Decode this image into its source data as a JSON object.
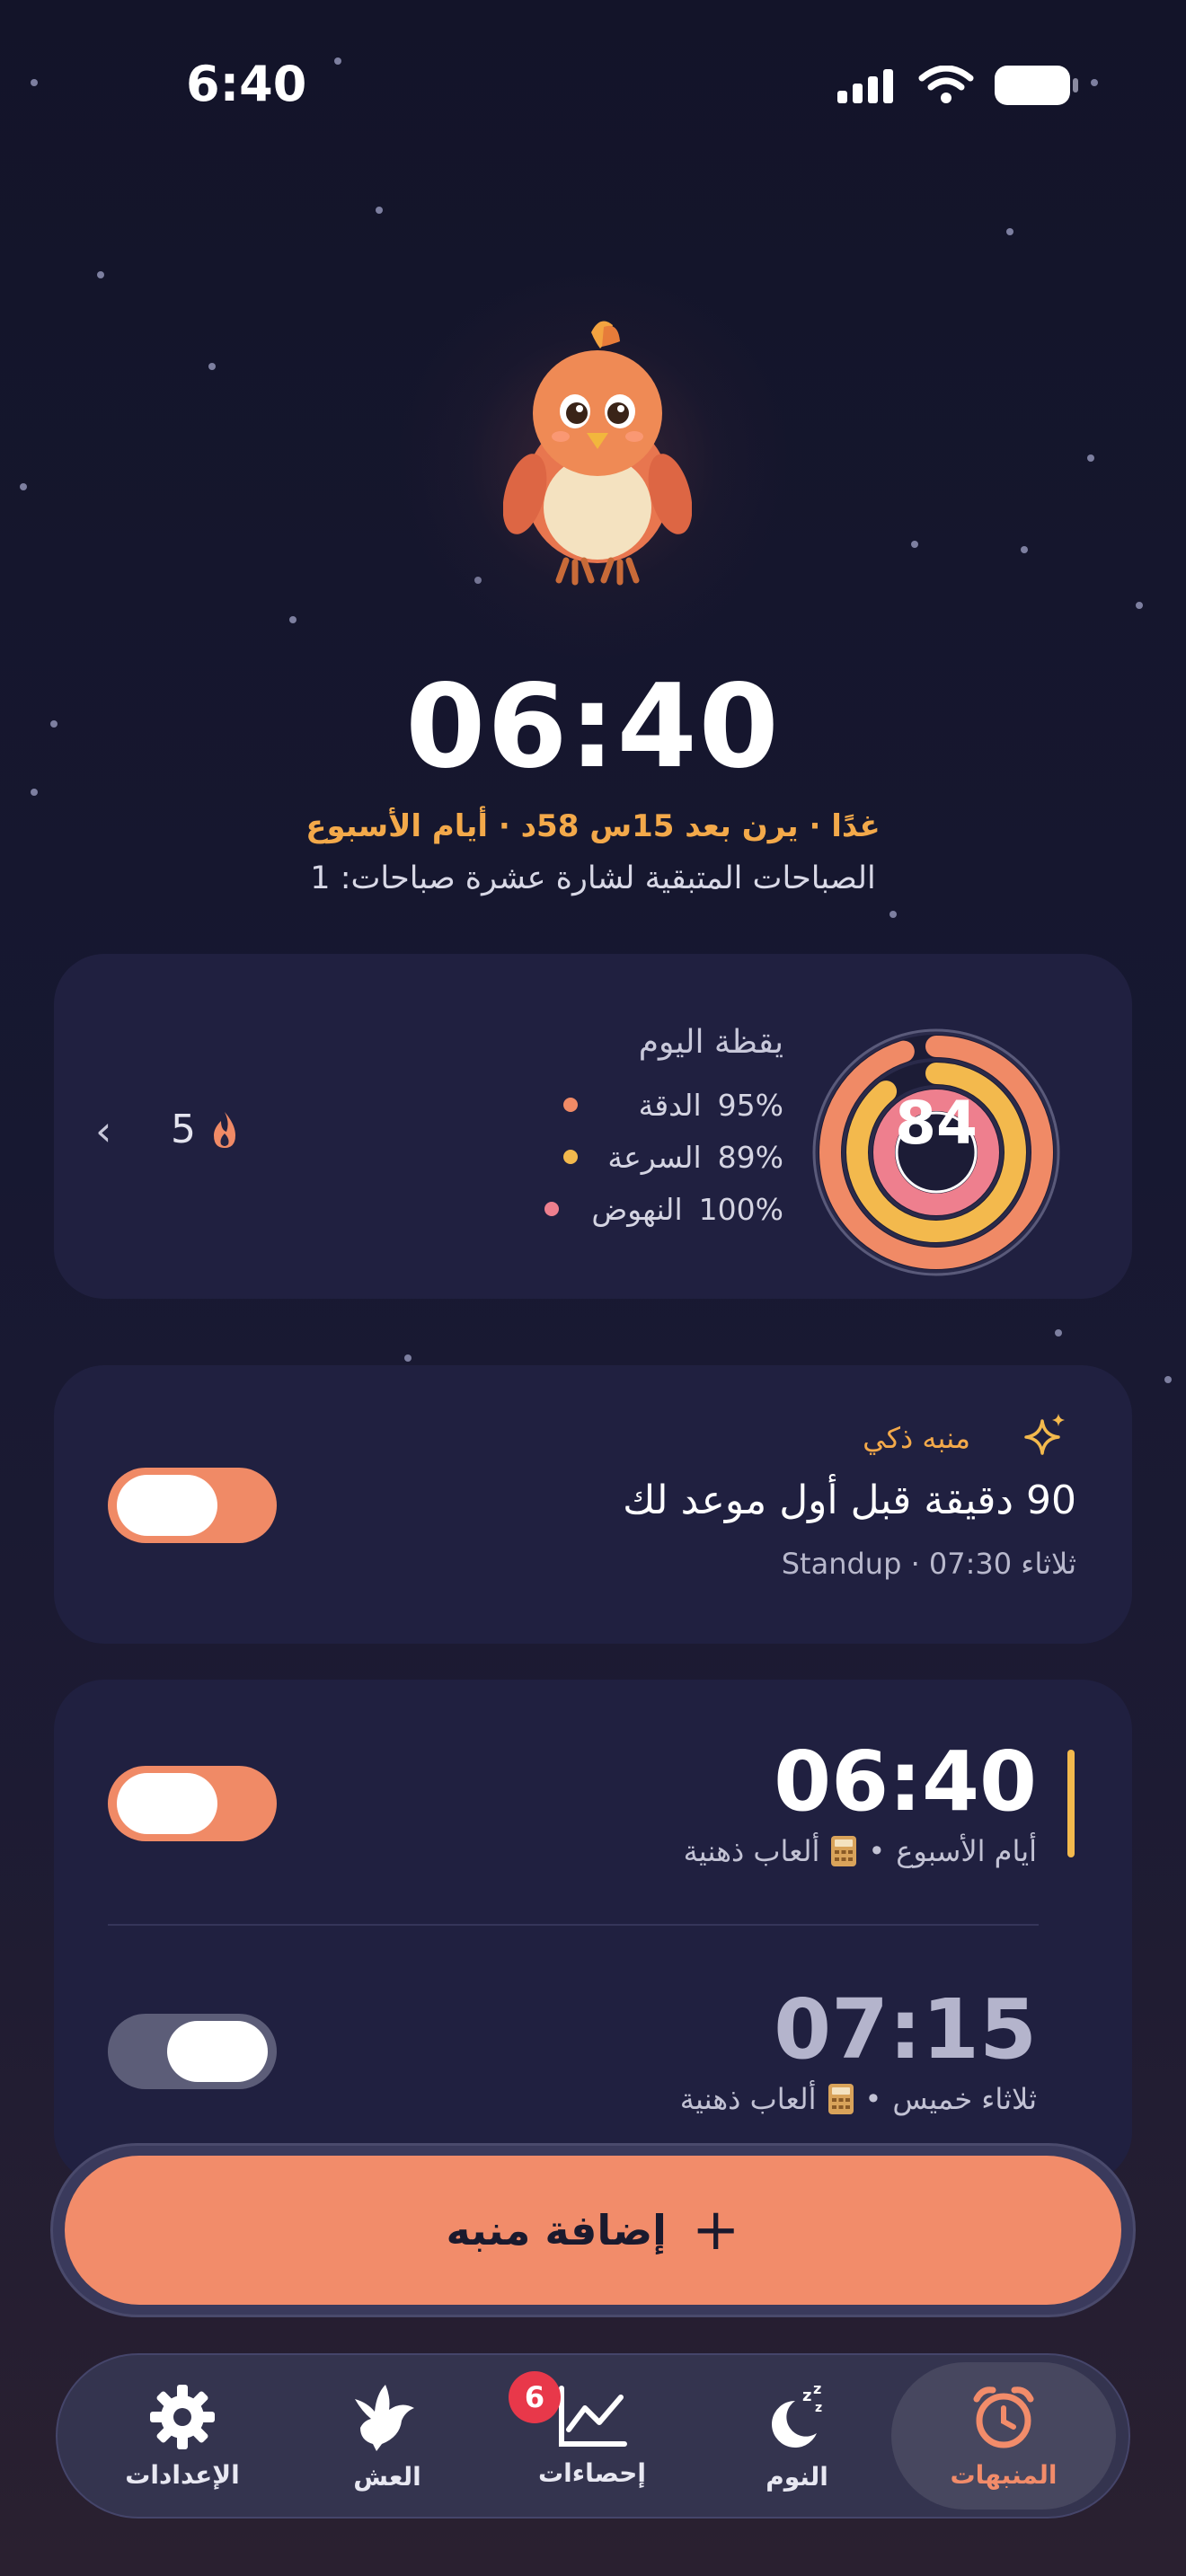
{
  "status_bar": {
    "time": "6:40"
  },
  "hero": {
    "alarm_time": "06:40",
    "next_ring": "غدًا · يرن بعد 15س 58د · أيام الأسبوع",
    "badge_progress": "الصباحات المتبقية لشارة عشرة صباحات: 1"
  },
  "wake_summary": {
    "title": "يقظة اليوم",
    "score": "84",
    "metrics": [
      {
        "label": "الدقة",
        "value": "95%",
        "fraction": 0.95,
        "color": "#f08a66"
      },
      {
        "label": "السرعة",
        "value": "89%",
        "fraction": 0.89,
        "color": "#f3b94d"
      },
      {
        "label": "النهوض",
        "value": "100%",
        "fraction": 1.0,
        "color": "#ee7f8e"
      }
    ],
    "streak": "5",
    "streak_icon": "flame-icon"
  },
  "smart_alarm": {
    "label": "منبه ذكي",
    "title": "90 دقيقة قبل أول موعد لك",
    "subtitle": "ثلاثاء 07:30 · Standup",
    "enabled": true
  },
  "alarms": [
    {
      "time": "06:40",
      "days": "أيام الأسبوع",
      "mission": "ألعاب ذهنية",
      "mission_icon": "calculator-icon",
      "enabled": true
    },
    {
      "time": "07:15",
      "days": "ثلاثاء خميس",
      "mission": "ألعاب ذهنية",
      "mission_icon": "calculator-icon",
      "enabled": false
    }
  ],
  "add_button": {
    "label": "إضافة منبه"
  },
  "tabs": [
    {
      "label": "المنبهات",
      "icon": "alarm-clock-icon",
      "active": true
    },
    {
      "label": "النوم",
      "icon": "moon-zzz-icon",
      "active": false
    },
    {
      "label": "إحصاءات",
      "icon": "chart-icon",
      "active": false,
      "badge": "6"
    },
    {
      "label": "العش",
      "icon": "bird-icon",
      "active": false
    },
    {
      "label": "الإعدادات",
      "icon": "gear-icon",
      "active": false
    }
  ],
  "colors": {
    "accent": "#f28c6a",
    "gold": "#f3a94a",
    "background": "#151630",
    "card": "#202040"
  }
}
